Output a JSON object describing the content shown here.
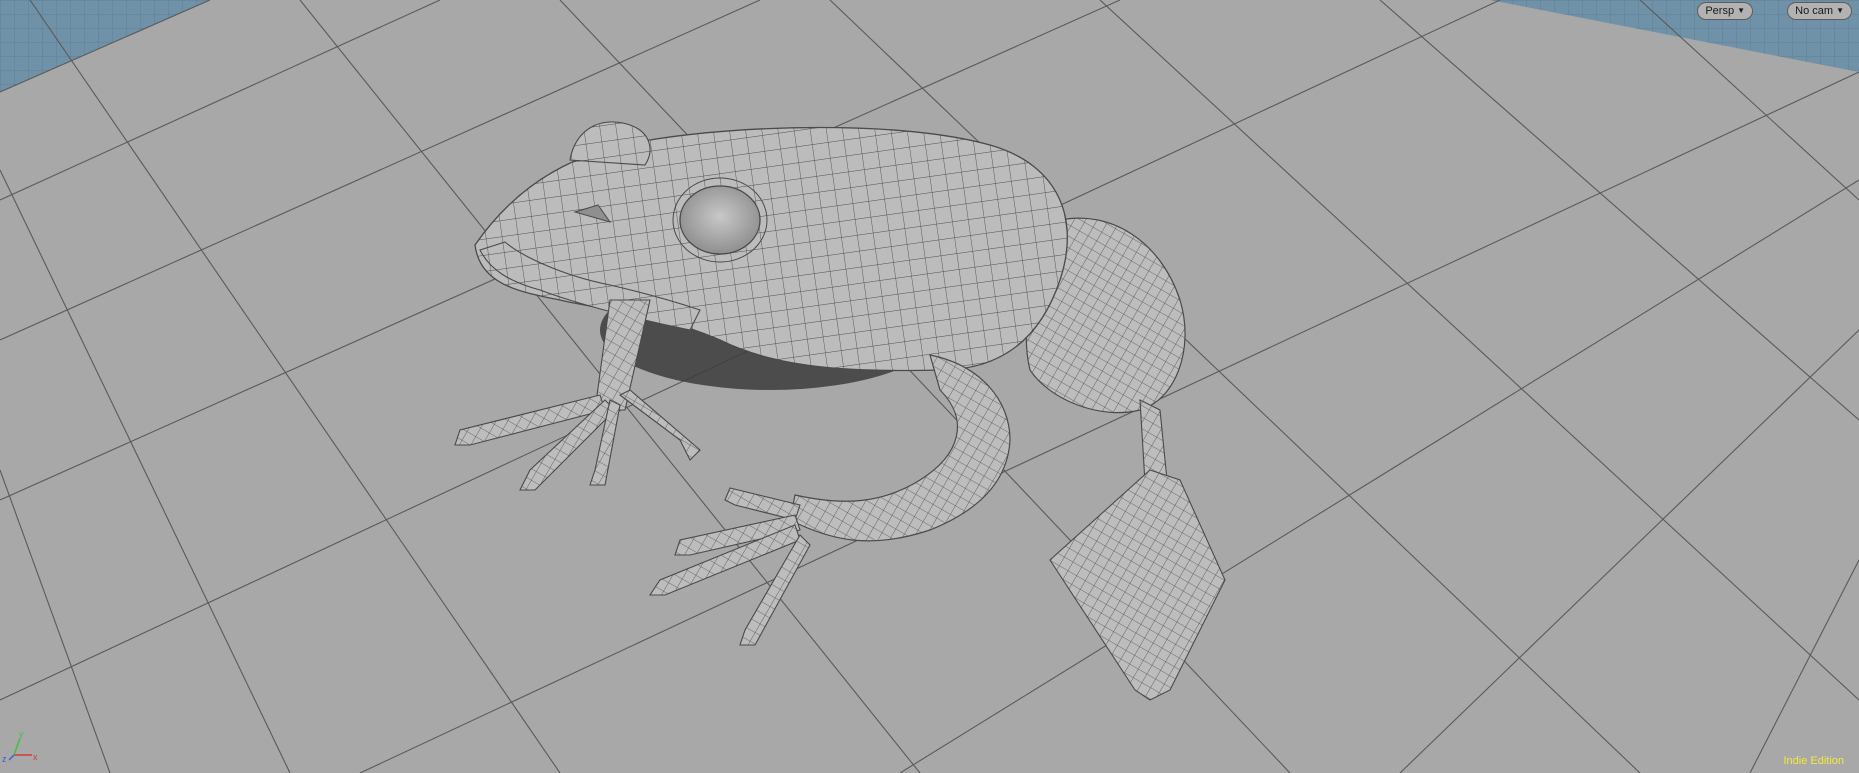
{
  "viewport": {
    "camera_menu_label": "Persp",
    "camera_selector_label": "No cam",
    "edition_label": "Indie Edition",
    "axis_labels": {
      "x": "x",
      "y": "y",
      "z": "z"
    },
    "colors": {
      "background": "#a8a8a8",
      "grid_line": "#5a5a5a",
      "horizon_plane": "#6f8fa6",
      "model_fill": "#bdbdbd",
      "wire": "#4b4b4b",
      "edition_text": "#f2ea3b",
      "axis_x": "#d23b3b",
      "axis_y": "#3fbf4a",
      "axis_z": "#3b63d2"
    }
  },
  "scene": {
    "object": "frog-mesh",
    "display_mode": "shaded with wireframe",
    "ground_grid": "on"
  }
}
